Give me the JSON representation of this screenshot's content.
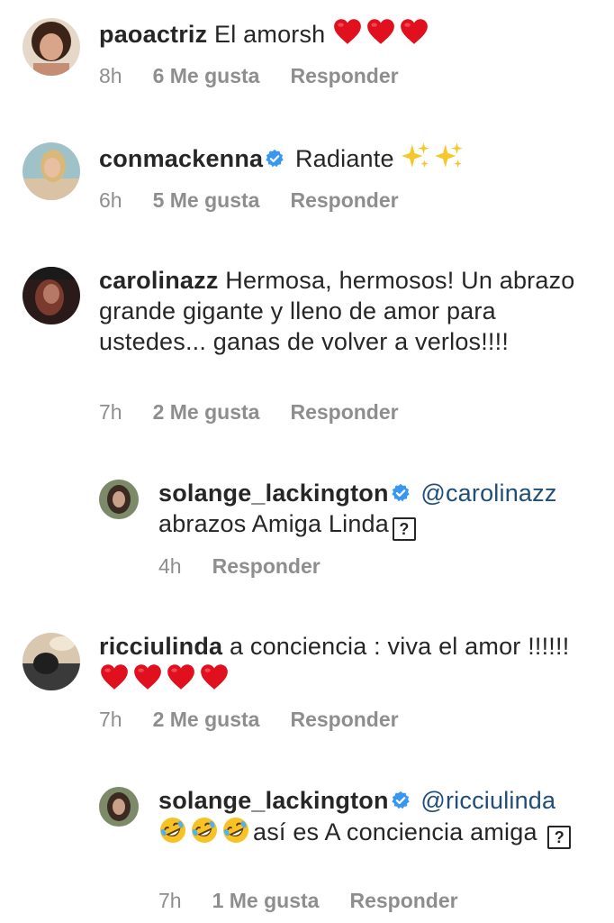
{
  "comments": [
    {
      "user": "paoactriz",
      "verified": false,
      "text": "El amorsh",
      "emojis": [
        "heart",
        "heart",
        "heart"
      ],
      "time": "8h",
      "likes": "6 Me gusta",
      "reply": "Responder"
    },
    {
      "user": "conmackenna",
      "verified": true,
      "text": "Radiante",
      "emojis": [
        "sparkles",
        "sparkles"
      ],
      "time": "6h",
      "likes": "5 Me gusta",
      "reply": "Responder"
    },
    {
      "user": "carolinazz",
      "verified": false,
      "text": "Hermosa, hermosos! Un abrazo grande gigante y lleno de amor para ustedes... ganas de volver a verlos!!!!",
      "time": "7h",
      "likes": "2 Me gusta",
      "reply": "Responder"
    },
    {
      "user": "solange_lackington",
      "verified": true,
      "mention": "@carolinazz",
      "text": "abrazos Amiga Linda",
      "time": "4h",
      "reply": "Responder"
    },
    {
      "user": "ricciulinda",
      "verified": false,
      "text": "a conciencia : viva el amor !!!!!!",
      "emojis": [
        "heart",
        "heart",
        "heart",
        "heart"
      ],
      "time": "7h",
      "likes": "2 Me gusta",
      "reply": "Responder"
    },
    {
      "user": "solange_lackington",
      "verified": true,
      "mention": "@ricciulinda",
      "text": "así es A conciencia amiga",
      "emojis": [
        "rofl",
        "rofl",
        "rofl"
      ],
      "time": "7h",
      "likes": "1 Me gusta",
      "reply": "Responder"
    }
  ],
  "colors": {
    "text": "#262626",
    "meta": "#8e8e8e",
    "mention": "#1e4e79",
    "verified": "#3897f0",
    "heart": "#e0101e"
  }
}
